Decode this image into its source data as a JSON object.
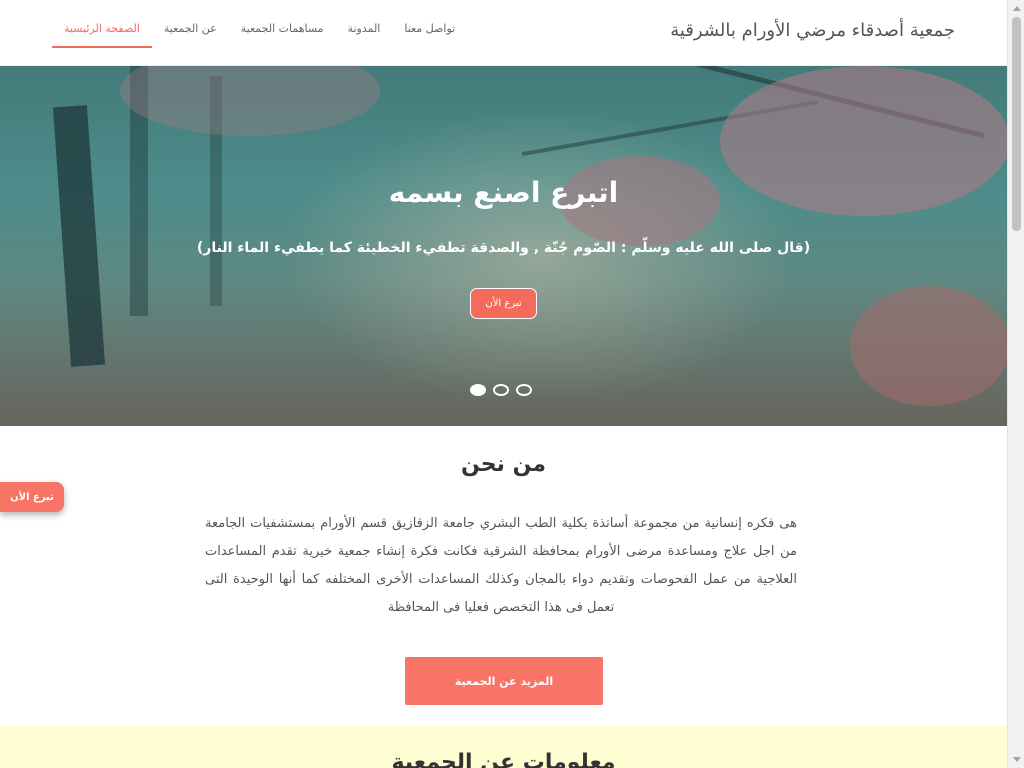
{
  "header": {
    "brand": "جمعية أصدقاء مرضي الأورام بالشرقية",
    "nav": [
      {
        "label": "الصفحة الرئيسية",
        "active": true
      },
      {
        "label": "عن الجمعية",
        "active": false
      },
      {
        "label": "مساهمات الجمعية",
        "active": false
      },
      {
        "label": "المدونة",
        "active": false
      },
      {
        "label": "تواصل معنا",
        "active": false
      }
    ]
  },
  "hero": {
    "title": "اتبرع اصنع بسمه",
    "subtitle": "(قال صلى الله عليه وسلّم : الصّوم جُنّة , والصدقة تطفيء الخطيئة كما يطفيء الماء النار)",
    "button": "تبرع الأن",
    "slides": 3,
    "active_slide": 0
  },
  "about": {
    "title": "من نحن",
    "text": "هى فكره إنسانية من مجموعة أساتذة بكلية الطب البشري جامعة الزقازيق قسم الأورام بمستشفيات الجامعة من اجل علاج ومساعدة مرضى الأورام بمحافظة الشرقية فكانت فكرة إنشاء جمعية خيرية تقدم المساعدات العلاجية من عمل الفحوصات وتقديم دواء بالمجان وكذلك المساعدات الأخرى المختلفه كما أنها الوحيدة التى تعمل فى هذا التخصص فعليا فى المحافظة",
    "button": "المزيد عن الجمعية"
  },
  "floating_donate": "تبرع الأن",
  "info": {
    "title": "معلومات عن الجمعية"
  },
  "colors": {
    "accent": "#f87466",
    "info_bg": "#fffed3"
  }
}
